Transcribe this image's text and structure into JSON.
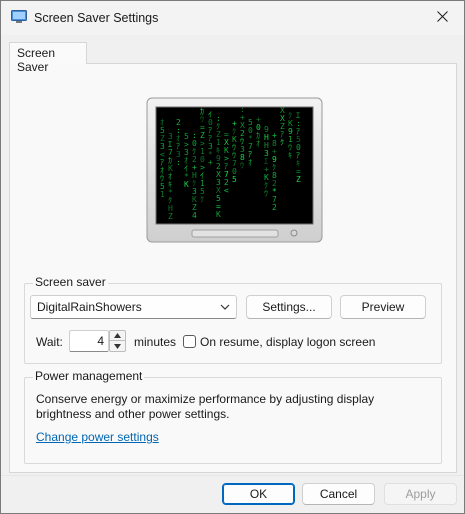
{
  "window": {
    "title": "Screen Saver Settings",
    "icon": "monitor-app-icon",
    "close_icon": "close-icon"
  },
  "tabs": [
    {
      "label": "Screen Saver",
      "selected": true
    }
  ],
  "preview": {
    "icon": "monitor-preview",
    "screen_style": "green-digital-rain"
  },
  "screen_saver": {
    "group_title": "Screen saver",
    "selected": "DigitalRainShowers",
    "settings_label": "Settings...",
    "preview_label": "Preview",
    "wait_label": "Wait:",
    "wait_value": "4",
    "minutes_label": "minutes",
    "resume_label": "On resume, display logon screen",
    "resume_checked": false
  },
  "power": {
    "group_title": "Power management",
    "description_line1": "Conserve energy or maximize performance by adjusting display",
    "description_line2": "brightness and other power settings.",
    "link_label": "Change power settings"
  },
  "footer": {
    "ok_label": "OK",
    "cancel_label": "Cancel",
    "apply_label": "Apply",
    "apply_enabled": false
  },
  "colors": {
    "accent": "#0067c0",
    "link": "#0066b4",
    "rain_green": "#19e04a"
  }
}
